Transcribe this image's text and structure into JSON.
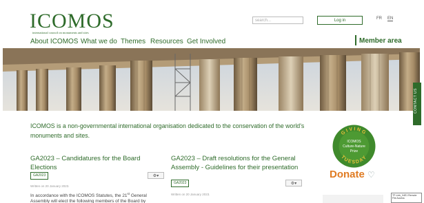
{
  "header": {
    "logo": "ICOMOS",
    "tagline": "international council on monuments and sites",
    "search_placeholder": "search...",
    "login_label": "Log in",
    "lang_fr": "FR",
    "lang_en": "EN",
    "member_area": "Member area"
  },
  "nav": {
    "items": [
      "About ICOMOS",
      "What we do",
      "Themes",
      "Resources",
      "Get Involved"
    ]
  },
  "sidebar": {
    "contact_label": "CONTACT US",
    "badge_top": "GIVING",
    "badge_line1": "ICOMOS",
    "badge_line2": "Culture-Nature",
    "badge_line3": "Prize",
    "badge_bottom": "TUESDAY",
    "donate_label": "Donate"
  },
  "intro": "ICOMOS is a non-governmental international organisation dedicated to the conservation of the world's monuments and sites.",
  "articles": [
    {
      "title": "GA2023 – Candidatures for the Board Elections",
      "tag": "GA2023",
      "date": "Written on 20 January 2023.",
      "body": "In accordance with the ICOMOS Statutes, the 21st General Assembly will elect the following members of the Board by"
    },
    {
      "title": "GA2023 – Draft resolutions for the General Assembly - Guidelines for their presentation",
      "tag": "GA2023",
      "date": "Written on 20 January 2023.",
      "body": ""
    }
  ],
  "widget_text": "TP-Link_04E1 Remote File Access",
  "colors": {
    "brand_green": "#2e6b2a",
    "donate_orange": "#e07b22",
    "badge_green": "#3f8a2c"
  },
  "icons": {
    "gear": "gear-icon",
    "chevron": "chevron-down-icon",
    "donate": "heart-hands-icon"
  }
}
